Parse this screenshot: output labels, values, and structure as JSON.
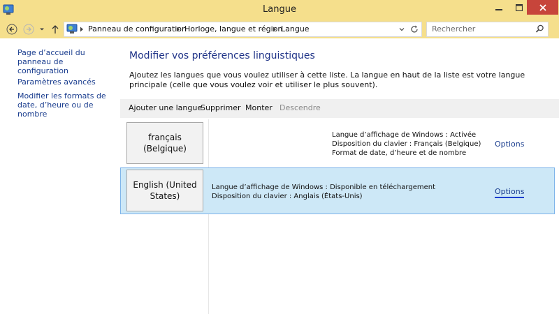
{
  "window": {
    "title": "Langue"
  },
  "address": {
    "breadcrumb": [
      "Panneau de configuration",
      "Horloge, langue et région",
      "Langue"
    ],
    "search_placeholder": "Rechercher"
  },
  "left_pane": {
    "links": [
      "Page d’accueil du panneau de configuration",
      "Paramètres avancés",
      "Modifier les formats de date, d’heure ou de nombre"
    ]
  },
  "main": {
    "heading": "Modifier vos préférences linguistiques",
    "description": "Ajoutez les langues que vous voulez utiliser à cette liste. La langue en haut de la liste est votre langue principale (celle que vous voulez voir et utiliser le plus souvent).",
    "toolbar": {
      "add": "Ajouter une langue",
      "remove": "Supprimer",
      "up": "Monter",
      "down": "Descendre"
    },
    "languages": [
      {
        "name": "français (Belgique)",
        "details": [
          "Langue d’affichage de Windows : Activée",
          "Disposition du clavier : Français (Belgique)",
          "Format de date, d’heure et de nombre"
        ],
        "options": "Options"
      },
      {
        "name": "English (United States)",
        "details": [
          "Langue d’affichage de Windows : Disponible en téléchargement",
          "Disposition du clavier : Anglais (États-Unis)"
        ],
        "options": "Options"
      }
    ]
  },
  "colors": {
    "titlebar": "#f5df8c",
    "close_button": "#c7453b",
    "link": "#1b3e8f",
    "heading": "#1e3287",
    "selected_row": "#cde8f7"
  }
}
